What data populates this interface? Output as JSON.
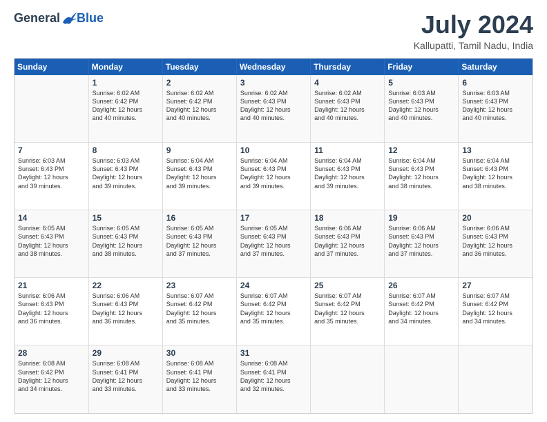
{
  "logo": {
    "general": "General",
    "blue": "Blue"
  },
  "title": "July 2024",
  "location": "Kallupatti, Tamil Nadu, India",
  "headers": [
    "Sunday",
    "Monday",
    "Tuesday",
    "Wednesday",
    "Thursday",
    "Friday",
    "Saturday"
  ],
  "weeks": [
    [
      {
        "date": "",
        "text": ""
      },
      {
        "date": "1",
        "text": "Sunrise: 6:02 AM\nSunset: 6:42 PM\nDaylight: 12 hours\nand 40 minutes."
      },
      {
        "date": "2",
        "text": "Sunrise: 6:02 AM\nSunset: 6:42 PM\nDaylight: 12 hours\nand 40 minutes."
      },
      {
        "date": "3",
        "text": "Sunrise: 6:02 AM\nSunset: 6:43 PM\nDaylight: 12 hours\nand 40 minutes."
      },
      {
        "date": "4",
        "text": "Sunrise: 6:02 AM\nSunset: 6:43 PM\nDaylight: 12 hours\nand 40 minutes."
      },
      {
        "date": "5",
        "text": "Sunrise: 6:03 AM\nSunset: 6:43 PM\nDaylight: 12 hours\nand 40 minutes."
      },
      {
        "date": "6",
        "text": "Sunrise: 6:03 AM\nSunset: 6:43 PM\nDaylight: 12 hours\nand 40 minutes."
      }
    ],
    [
      {
        "date": "7",
        "text": "Sunrise: 6:03 AM\nSunset: 6:43 PM\nDaylight: 12 hours\nand 39 minutes."
      },
      {
        "date": "8",
        "text": "Sunrise: 6:03 AM\nSunset: 6:43 PM\nDaylight: 12 hours\nand 39 minutes."
      },
      {
        "date": "9",
        "text": "Sunrise: 6:04 AM\nSunset: 6:43 PM\nDaylight: 12 hours\nand 39 minutes."
      },
      {
        "date": "10",
        "text": "Sunrise: 6:04 AM\nSunset: 6:43 PM\nDaylight: 12 hours\nand 39 minutes."
      },
      {
        "date": "11",
        "text": "Sunrise: 6:04 AM\nSunset: 6:43 PM\nDaylight: 12 hours\nand 39 minutes."
      },
      {
        "date": "12",
        "text": "Sunrise: 6:04 AM\nSunset: 6:43 PM\nDaylight: 12 hours\nand 38 minutes."
      },
      {
        "date": "13",
        "text": "Sunrise: 6:04 AM\nSunset: 6:43 PM\nDaylight: 12 hours\nand 38 minutes."
      }
    ],
    [
      {
        "date": "14",
        "text": "Sunrise: 6:05 AM\nSunset: 6:43 PM\nDaylight: 12 hours\nand 38 minutes."
      },
      {
        "date": "15",
        "text": "Sunrise: 6:05 AM\nSunset: 6:43 PM\nDaylight: 12 hours\nand 38 minutes."
      },
      {
        "date": "16",
        "text": "Sunrise: 6:05 AM\nSunset: 6:43 PM\nDaylight: 12 hours\nand 37 minutes."
      },
      {
        "date": "17",
        "text": "Sunrise: 6:05 AM\nSunset: 6:43 PM\nDaylight: 12 hours\nand 37 minutes."
      },
      {
        "date": "18",
        "text": "Sunrise: 6:06 AM\nSunset: 6:43 PM\nDaylight: 12 hours\nand 37 minutes."
      },
      {
        "date": "19",
        "text": "Sunrise: 6:06 AM\nSunset: 6:43 PM\nDaylight: 12 hours\nand 37 minutes."
      },
      {
        "date": "20",
        "text": "Sunrise: 6:06 AM\nSunset: 6:43 PM\nDaylight: 12 hours\nand 36 minutes."
      }
    ],
    [
      {
        "date": "21",
        "text": "Sunrise: 6:06 AM\nSunset: 6:43 PM\nDaylight: 12 hours\nand 36 minutes."
      },
      {
        "date": "22",
        "text": "Sunrise: 6:06 AM\nSunset: 6:43 PM\nDaylight: 12 hours\nand 36 minutes."
      },
      {
        "date": "23",
        "text": "Sunrise: 6:07 AM\nSunset: 6:42 PM\nDaylight: 12 hours\nand 35 minutes."
      },
      {
        "date": "24",
        "text": "Sunrise: 6:07 AM\nSunset: 6:42 PM\nDaylight: 12 hours\nand 35 minutes."
      },
      {
        "date": "25",
        "text": "Sunrise: 6:07 AM\nSunset: 6:42 PM\nDaylight: 12 hours\nand 35 minutes."
      },
      {
        "date": "26",
        "text": "Sunrise: 6:07 AM\nSunset: 6:42 PM\nDaylight: 12 hours\nand 34 minutes."
      },
      {
        "date": "27",
        "text": "Sunrise: 6:07 AM\nSunset: 6:42 PM\nDaylight: 12 hours\nand 34 minutes."
      }
    ],
    [
      {
        "date": "28",
        "text": "Sunrise: 6:08 AM\nSunset: 6:42 PM\nDaylight: 12 hours\nand 34 minutes."
      },
      {
        "date": "29",
        "text": "Sunrise: 6:08 AM\nSunset: 6:41 PM\nDaylight: 12 hours\nand 33 minutes."
      },
      {
        "date": "30",
        "text": "Sunrise: 6:08 AM\nSunset: 6:41 PM\nDaylight: 12 hours\nand 33 minutes."
      },
      {
        "date": "31",
        "text": "Sunrise: 6:08 AM\nSunset: 6:41 PM\nDaylight: 12 hours\nand 32 minutes."
      },
      {
        "date": "",
        "text": ""
      },
      {
        "date": "",
        "text": ""
      },
      {
        "date": "",
        "text": ""
      }
    ]
  ]
}
